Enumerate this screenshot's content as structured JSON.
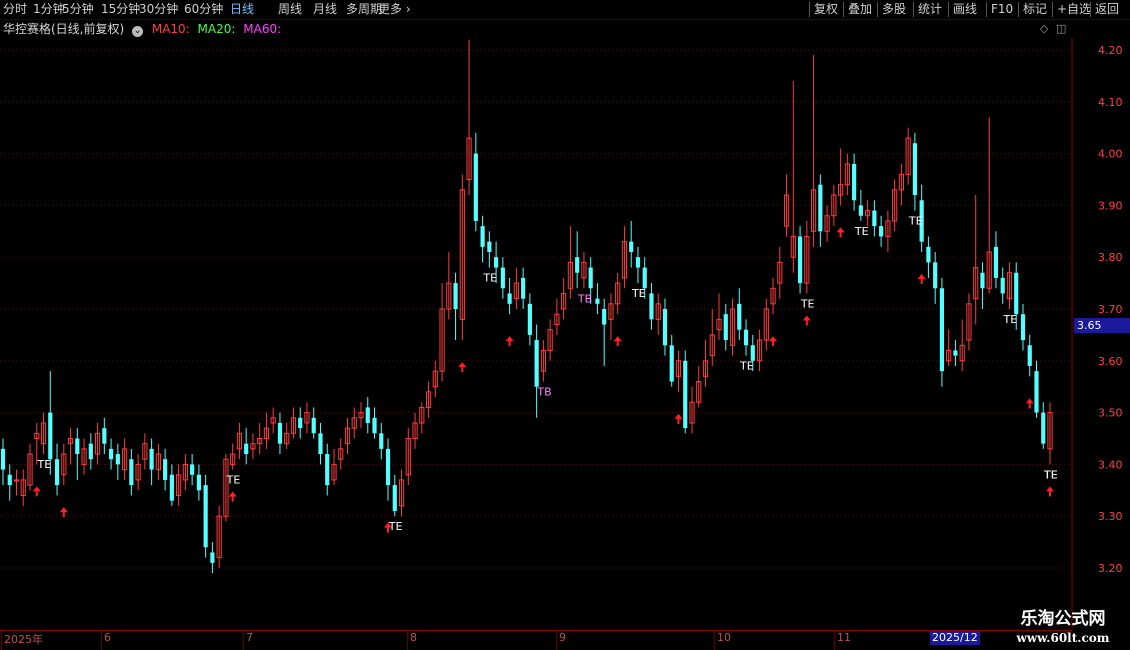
{
  "toolbar": {
    "periods": [
      "分时",
      "1分钟",
      "5分钟",
      "15分钟",
      "30分钟",
      "60分钟",
      "日线",
      "周线",
      "月线",
      "多周期",
      "更多"
    ],
    "active_period": "日线",
    "right_buttons": [
      "复权",
      "叠加",
      "多股",
      "统计",
      "画线",
      "F10",
      "标记",
      "+自选",
      "返回"
    ]
  },
  "title": {
    "stock": "华控赛格(日线,前复权)",
    "ma10": "MA10:",
    "ma20": "MA20:",
    "ma60": "MA60:"
  },
  "colors": {
    "up": "#ff3c3c",
    "down": "#54ffff",
    "ma10": "#ff4040",
    "ma20": "#40ff40",
    "ma60": "#ff40ff",
    "grid": "#6a0000",
    "axis_text": "#ff4040"
  },
  "price_axis": {
    "labels": [
      "4.20",
      "4.10",
      "4.00",
      "3.90",
      "3.80",
      "3.70",
      "3.60",
      "3.50",
      "3.40",
      "3.30",
      "3.20"
    ],
    "current_price": "3.65"
  },
  "date_axis": {
    "labels": [
      "2025年",
      "6",
      "7",
      "8",
      "9",
      "10",
      "11"
    ],
    "highlight": "2025/12"
  },
  "watermark": {
    "line1": "乐淘公式网",
    "line2": "www.60lt.com"
  },
  "chart_data": {
    "type": "candlestick",
    "y_range": [
      3.15,
      4.25
    ],
    "candles": [
      [
        3.43,
        3.39,
        3.45,
        3.36
      ],
      [
        3.38,
        3.36,
        3.4,
        3.33
      ],
      [
        3.37,
        3.37,
        3.39,
        3.34
      ],
      [
        3.34,
        3.37,
        3.39,
        3.32
      ],
      [
        3.36,
        3.42,
        3.44,
        3.35
      ],
      [
        3.45,
        3.46,
        3.48,
        3.4
      ],
      [
        3.44,
        3.48,
        3.5,
        3.42
      ],
      [
        3.5,
        3.41,
        3.58,
        3.38
      ],
      [
        3.41,
        3.36,
        3.44,
        3.34
      ],
      [
        3.38,
        3.42,
        3.44,
        3.36
      ],
      [
        3.44,
        3.45,
        3.47,
        3.4
      ],
      [
        3.45,
        3.42,
        3.47,
        3.37
      ],
      [
        3.4,
        3.43,
        3.45,
        3.38
      ],
      [
        3.44,
        3.41,
        3.46,
        3.39
      ],
      [
        3.42,
        3.46,
        3.48,
        3.4
      ],
      [
        3.47,
        3.44,
        3.49,
        3.42
      ],
      [
        3.43,
        3.41,
        3.45,
        3.39
      ],
      [
        3.42,
        3.4,
        3.44,
        3.37
      ],
      [
        3.39,
        3.43,
        3.45,
        3.37
      ],
      [
        3.41,
        3.36,
        3.43,
        3.34
      ],
      [
        3.37,
        3.4,
        3.42,
        3.35
      ],
      [
        3.41,
        3.44,
        3.46,
        3.39
      ],
      [
        3.43,
        3.39,
        3.45,
        3.36
      ],
      [
        3.39,
        3.42,
        3.44,
        3.37
      ],
      [
        3.41,
        3.37,
        3.43,
        3.35
      ],
      [
        3.38,
        3.33,
        3.4,
        3.32
      ],
      [
        3.34,
        3.38,
        3.4,
        3.32
      ],
      [
        3.37,
        3.4,
        3.42,
        3.35
      ],
      [
        3.4,
        3.38,
        3.42,
        3.36
      ],
      [
        3.38,
        3.35,
        3.4,
        3.33
      ],
      [
        3.36,
        3.24,
        3.38,
        3.22
      ],
      [
        3.23,
        3.21,
        3.25,
        3.19
      ],
      [
        3.22,
        3.3,
        3.32,
        3.2
      ],
      [
        3.3,
        3.41,
        3.42,
        3.29
      ],
      [
        3.4,
        3.42,
        3.44,
        3.39
      ],
      [
        3.43,
        3.46,
        3.48,
        3.41
      ],
      [
        3.44,
        3.42,
        3.47,
        3.4
      ],
      [
        3.43,
        3.44,
        3.46,
        3.41
      ],
      [
        3.44,
        3.45,
        3.48,
        3.42
      ],
      [
        3.45,
        3.47,
        3.5,
        3.43
      ],
      [
        3.48,
        3.49,
        3.51,
        3.46
      ],
      [
        3.48,
        3.44,
        3.5,
        3.42
      ],
      [
        3.44,
        3.46,
        3.48,
        3.43
      ],
      [
        3.46,
        3.49,
        3.51,
        3.45
      ],
      [
        3.49,
        3.47,
        3.51,
        3.45
      ],
      [
        3.48,
        3.5,
        3.52,
        3.46
      ],
      [
        3.49,
        3.46,
        3.51,
        3.45
      ],
      [
        3.46,
        3.42,
        3.48,
        3.4
      ],
      [
        3.42,
        3.36,
        3.44,
        3.34
      ],
      [
        3.37,
        3.4,
        3.43,
        3.36
      ],
      [
        3.41,
        3.43,
        3.45,
        3.39
      ],
      [
        3.44,
        3.47,
        3.49,
        3.42
      ],
      [
        3.47,
        3.49,
        3.51,
        3.45
      ],
      [
        3.49,
        3.5,
        3.52,
        3.47
      ],
      [
        3.51,
        3.48,
        3.53,
        3.46
      ],
      [
        3.49,
        3.46,
        3.51,
        3.45
      ],
      [
        3.46,
        3.43,
        3.48,
        3.41
      ],
      [
        3.43,
        3.36,
        3.45,
        3.33
      ],
      [
        3.36,
        3.31,
        3.38,
        3.3
      ],
      [
        3.32,
        3.37,
        3.39,
        3.3
      ],
      [
        3.38,
        3.45,
        3.47,
        3.36
      ],
      [
        3.45,
        3.48,
        3.5,
        3.43
      ],
      [
        3.48,
        3.51,
        3.52,
        3.46
      ],
      [
        3.51,
        3.54,
        3.56,
        3.49
      ],
      [
        3.55,
        3.58,
        3.6,
        3.53
      ],
      [
        3.58,
        3.7,
        3.75,
        3.56
      ],
      [
        3.7,
        3.75,
        3.81,
        3.68
      ],
      [
        3.75,
        3.7,
        3.77,
        3.64
      ],
      [
        3.68,
        3.93,
        3.96,
        3.64
      ],
      [
        3.95,
        4.03,
        4.22,
        3.92
      ],
      [
        4.0,
        3.87,
        4.04,
        3.85
      ],
      [
        3.86,
        3.82,
        3.88,
        3.79
      ],
      [
        3.83,
        3.81,
        3.85,
        3.78
      ],
      [
        3.8,
        3.78,
        3.83,
        3.75
      ],
      [
        3.78,
        3.74,
        3.8,
        3.72
      ],
      [
        3.73,
        3.71,
        3.76,
        3.69
      ],
      [
        3.72,
        3.75,
        3.78,
        3.7
      ],
      [
        3.76,
        3.72,
        3.78,
        3.7
      ],
      [
        3.71,
        3.65,
        3.73,
        3.63
      ],
      [
        3.64,
        3.55,
        3.67,
        3.49
      ],
      [
        3.58,
        3.62,
        3.64,
        3.56
      ],
      [
        3.62,
        3.66,
        3.68,
        3.6
      ],
      [
        3.67,
        3.69,
        3.72,
        3.65
      ],
      [
        3.7,
        3.73,
        3.76,
        3.68
      ],
      [
        3.74,
        3.79,
        3.86,
        3.72
      ],
      [
        3.8,
        3.77,
        3.85,
        3.74
      ],
      [
        3.76,
        3.79,
        3.81,
        3.74
      ],
      [
        3.78,
        3.74,
        3.8,
        3.71
      ],
      [
        3.72,
        3.71,
        3.75,
        3.69
      ],
      [
        3.7,
        3.67,
        3.72,
        3.59
      ],
      [
        3.68,
        3.71,
        3.73,
        3.64
      ],
      [
        3.71,
        3.75,
        3.77,
        3.69
      ],
      [
        3.76,
        3.83,
        3.86,
        3.74
      ],
      [
        3.83,
        3.81,
        3.87,
        3.78
      ],
      [
        3.8,
        3.78,
        3.82,
        3.75
      ],
      [
        3.78,
        3.74,
        3.8,
        3.72
      ],
      [
        3.73,
        3.68,
        3.75,
        3.66
      ],
      [
        3.68,
        3.71,
        3.73,
        3.65
      ],
      [
        3.7,
        3.63,
        3.72,
        3.61
      ],
      [
        3.63,
        3.56,
        3.65,
        3.55
      ],
      [
        3.57,
        3.6,
        3.62,
        3.54
      ],
      [
        3.6,
        3.47,
        3.62,
        3.46
      ],
      [
        3.48,
        3.52,
        3.55,
        3.46
      ],
      [
        3.52,
        3.56,
        3.59,
        3.51
      ],
      [
        3.57,
        3.6,
        3.64,
        3.55
      ],
      [
        3.61,
        3.65,
        3.7,
        3.59
      ],
      [
        3.66,
        3.68,
        3.73,
        3.64
      ],
      [
        3.69,
        3.64,
        3.71,
        3.62
      ],
      [
        3.63,
        3.7,
        3.72,
        3.61
      ],
      [
        3.71,
        3.66,
        3.74,
        3.64
      ],
      [
        3.66,
        3.63,
        3.68,
        3.61
      ],
      [
        3.63,
        3.6,
        3.65,
        3.58
      ],
      [
        3.6,
        3.64,
        3.66,
        3.58
      ],
      [
        3.64,
        3.7,
        3.72,
        3.62
      ],
      [
        3.71,
        3.74,
        3.76,
        3.69
      ],
      [
        3.75,
        3.79,
        3.82,
        3.72
      ],
      [
        3.86,
        3.92,
        3.96,
        3.84
      ],
      [
        3.8,
        3.84,
        4.14,
        3.77
      ],
      [
        3.84,
        3.75,
        3.86,
        3.73
      ],
      [
        3.75,
        3.84,
        3.87,
        3.73
      ],
      [
        3.85,
        3.93,
        4.19,
        3.82
      ],
      [
        3.94,
        3.85,
        3.96,
        3.82
      ],
      [
        3.85,
        3.88,
        3.9,
        3.83
      ],
      [
        3.88,
        3.92,
        3.94,
        3.86
      ],
      [
        3.92,
        3.94,
        4.01,
        3.9
      ],
      [
        3.94,
        3.98,
        4.0,
        3.92
      ],
      [
        3.98,
        3.91,
        4.0,
        3.89
      ],
      [
        3.9,
        3.88,
        3.93,
        3.87
      ],
      [
        3.88,
        3.89,
        3.91,
        3.86
      ],
      [
        3.89,
        3.86,
        3.91,
        3.84
      ],
      [
        3.86,
        3.84,
        3.88,
        3.82
      ],
      [
        3.84,
        3.87,
        3.89,
        3.81
      ],
      [
        3.87,
        3.93,
        3.95,
        3.85
      ],
      [
        3.93,
        3.96,
        3.98,
        3.9
      ],
      [
        3.96,
        4.03,
        4.05,
        3.94
      ],
      [
        4.02,
        3.92,
        4.04,
        3.89
      ],
      [
        3.91,
        3.83,
        3.94,
        3.81
      ],
      [
        3.82,
        3.79,
        3.84,
        3.76
      ],
      [
        3.79,
        3.74,
        3.81,
        3.71
      ],
      [
        3.74,
        3.58,
        3.76,
        3.55
      ],
      [
        3.6,
        3.62,
        3.66,
        3.59
      ],
      [
        3.62,
        3.61,
        3.64,
        3.59
      ],
      [
        3.6,
        3.63,
        3.68,
        3.58
      ],
      [
        3.64,
        3.71,
        3.73,
        3.62
      ],
      [
        3.72,
        3.78,
        3.92,
        3.67
      ],
      [
        3.77,
        3.74,
        3.79,
        3.7
      ],
      [
        3.74,
        3.81,
        4.07,
        3.73
      ],
      [
        3.82,
        3.76,
        3.85,
        3.74
      ],
      [
        3.76,
        3.73,
        3.78,
        3.71
      ],
      [
        3.72,
        3.77,
        3.79,
        3.7
      ],
      [
        3.77,
        3.69,
        3.79,
        3.66
      ],
      [
        3.69,
        3.64,
        3.71,
        3.62
      ],
      [
        3.63,
        3.59,
        3.65,
        3.57
      ],
      [
        3.58,
        3.5,
        3.6,
        3.49
      ],
      [
        3.5,
        3.44,
        3.52,
        3.43
      ],
      [
        3.43,
        3.5,
        3.52,
        3.4
      ]
    ],
    "arrows": [
      5,
      9,
      34,
      57,
      68,
      75,
      91,
      100,
      114,
      119,
      124,
      136,
      152,
      165
    ],
    "te_labels": [
      [
        6,
        "TE"
      ],
      [
        34,
        "TE"
      ],
      [
        58,
        "TE"
      ],
      [
        72,
        "TE"
      ],
      [
        94,
        "TE"
      ],
      [
        110,
        "TE"
      ],
      [
        119,
        "TE"
      ],
      [
        127,
        "TE"
      ],
      [
        135,
        "TE"
      ],
      [
        149,
        "TE"
      ],
      [
        168,
        "TE"
      ],
      [
        179,
        "TE"
      ]
    ],
    "tb_labels": [
      [
        80,
        "TB"
      ],
      [
        86,
        "TB"
      ]
    ]
  }
}
